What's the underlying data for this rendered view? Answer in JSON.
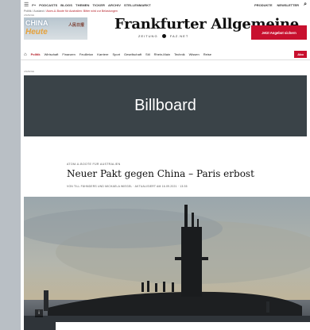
{
  "topbar": {
    "menu_icon": "☰",
    "nav": [
      "F+",
      "PODCASTS",
      "BLOGS",
      "THEMEN",
      "TICKER",
      "ARCHIV",
      "STELLENMARKT"
    ],
    "right": [
      "PRODUKTE",
      "NEWSLETTER"
    ]
  },
  "breadcrumb": {
    "path": "Politik / Ausland /",
    "current": "Atom-U-Boote für Australien: Bitter wird zur Belastungen"
  },
  "ad_label": "ANZEIGE",
  "ad_china": {
    "line1": "CHINA",
    "line2": "Heute",
    "logo": "人民日报"
  },
  "masthead": {
    "title": "Frankfurter Allgemeine",
    "sub_left": "ZEITUNG",
    "sub_right": "FAZ.NET"
  },
  "offer_button": "Jetzt Angebot sichern",
  "nav": {
    "items": [
      "Politik",
      "Wirtschaft",
      "Finanzen",
      "Feuilleton",
      "Karriere",
      "Sport",
      "Gesellschaft",
      "Stil",
      "Rhein-Main",
      "Technik",
      "Wissen",
      "Reise"
    ],
    "abo": "Abo"
  },
  "billboard": "Billboard",
  "article": {
    "kicker": "ATOM-U-BOOTE FÜR AUSTRALIEN",
    "headline": "Neuer Pakt gegen China – Paris erbost",
    "byline": "VON TILL FÄHNDERS UND MICHAELA WIEGEL  ·  AKTUALISIERT AM 16.09.2021  ·  13:35"
  },
  "image_badge": "i"
}
